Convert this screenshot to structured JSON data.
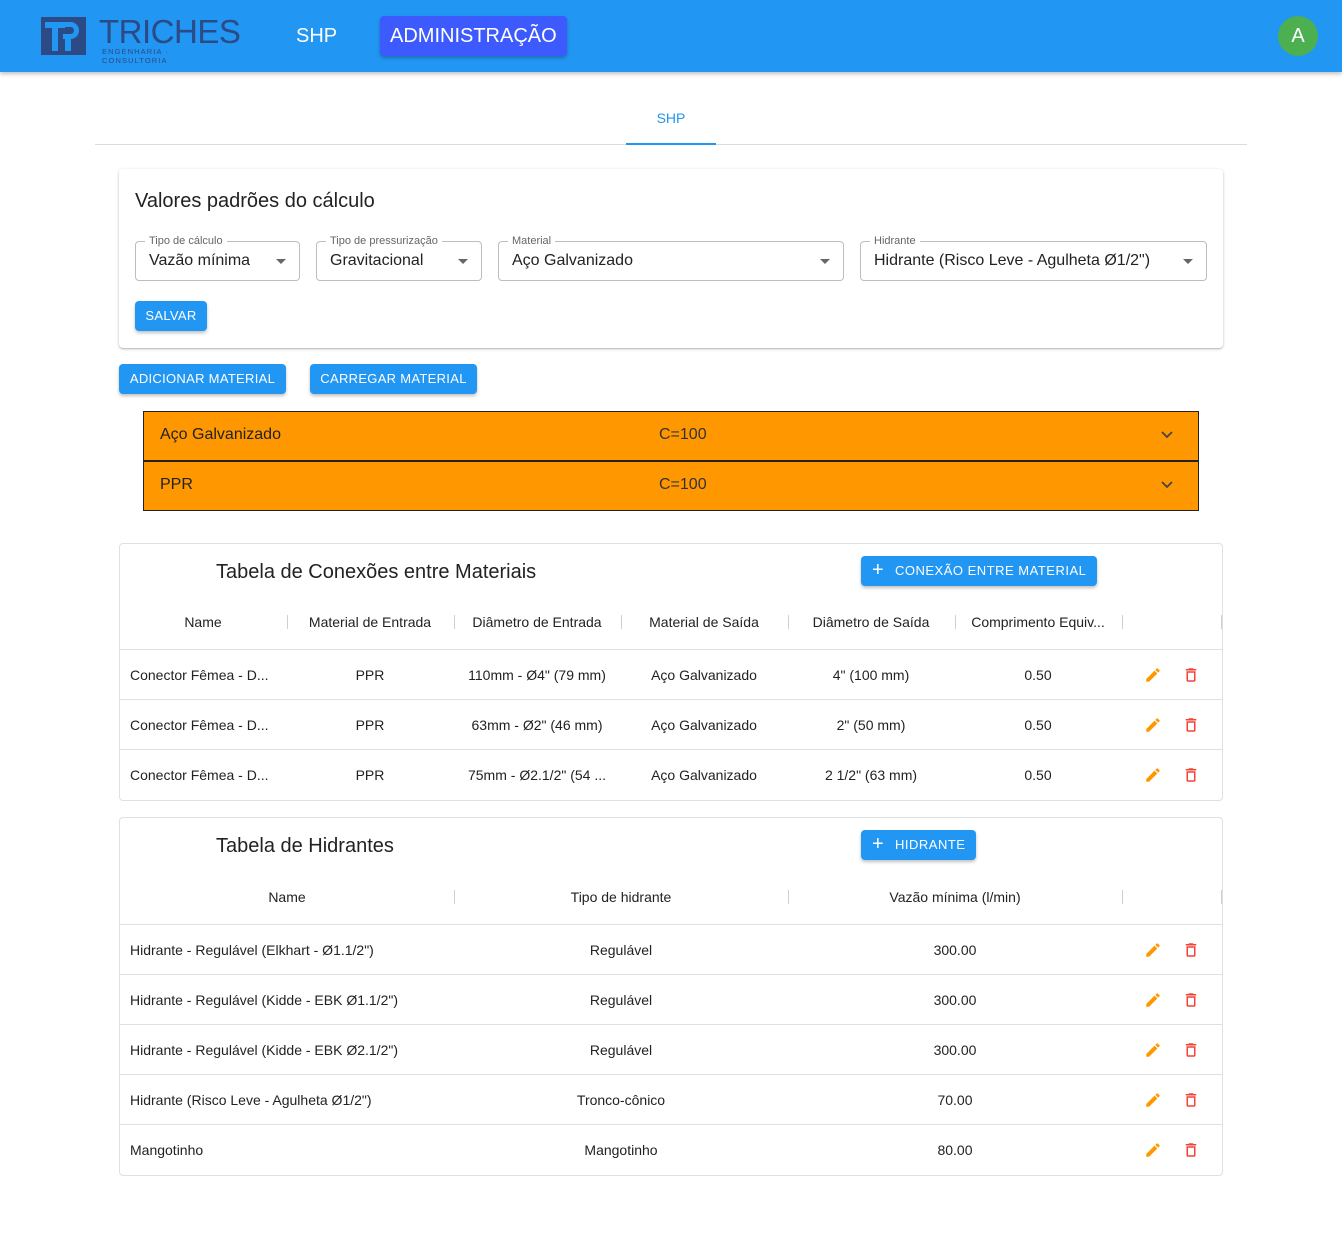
{
  "header": {
    "logo_word": "TRICHES",
    "logo_sub": "ENGENHARIA · CONSULTORIA",
    "nav": [
      "SHP",
      "ADMINISTRAÇÃO"
    ],
    "avatar_initial": "A"
  },
  "tabs": [
    "SHP"
  ],
  "defaults_card": {
    "title": "Valores padrões do cálculo",
    "fields": [
      {
        "label": "Tipo de cálculo",
        "value": "Vazão mínima"
      },
      {
        "label": "Tipo de pressurização",
        "value": "Gravitacional"
      },
      {
        "label": "Material",
        "value": "Aço Galvanizado"
      },
      {
        "label": "Hidrante",
        "value": "Hidrante (Risco Leve - Agulheta Ø1/2\")"
      }
    ],
    "save_label": "SALVAR"
  },
  "material_actions": {
    "add_label": "ADICIONAR MATERIAL",
    "load_label": "CARREGAR MATERIAL"
  },
  "materials": [
    {
      "name": "Aço Galvanizado",
      "c": "C=100"
    },
    {
      "name": "PPR",
      "c": "C=100"
    }
  ],
  "colors": {
    "primary": "#2196f3",
    "accent": "#3d5afe",
    "material_row": "#ff9800",
    "edit": "#ff9800",
    "delete": "#f44336",
    "avatar": "#4caf50"
  },
  "connections": {
    "title": "Tabela de Conexões entre Materiais",
    "add_label": "CONEXÃO ENTRE MATERIAL",
    "columns": [
      "Name",
      "Material de Entrada",
      "Diâmetro de Entrada",
      "Material de Saída",
      "Diâmetro de Saída",
      "Comprimento Equiv..."
    ],
    "rows": [
      [
        "Conector Fêmea - D...",
        "PPR",
        "110mm - Ø4\" (79 mm)",
        "Aço Galvanizado",
        "4\" (100 mm)",
        "0.50"
      ],
      [
        "Conector Fêmea - D...",
        "PPR",
        "63mm - Ø2\" (46 mm)",
        "Aço Galvanizado",
        "2\" (50 mm)",
        "0.50"
      ],
      [
        "Conector Fêmea - D...",
        "PPR",
        "75mm - Ø2.1/2\" (54 ...",
        "Aço Galvanizado",
        "2 1/2\" (63 mm)",
        "0.50"
      ]
    ]
  },
  "hydrants": {
    "title": "Tabela de Hidrantes",
    "add_label": "HIDRANTE",
    "columns": [
      "Name",
      "Tipo de hidrante",
      "Vazão mínima (l/min)"
    ],
    "rows": [
      [
        "Hidrante - Regulável (Elkhart - Ø1.1/2\")",
        "Regulável",
        "300.00"
      ],
      [
        "Hidrante - Regulável (Kidde - EBK Ø1.1/2\")",
        "Regulável",
        "300.00"
      ],
      [
        "Hidrante - Regulável (Kidde - EBK Ø2.1/2\")",
        "Regulável",
        "300.00"
      ],
      [
        "Hidrante (Risco Leve - Agulheta Ø1/2\")",
        "Tronco-cônico",
        "70.00"
      ],
      [
        "Mangotinho",
        "Mangotinho",
        "80.00"
      ]
    ]
  }
}
